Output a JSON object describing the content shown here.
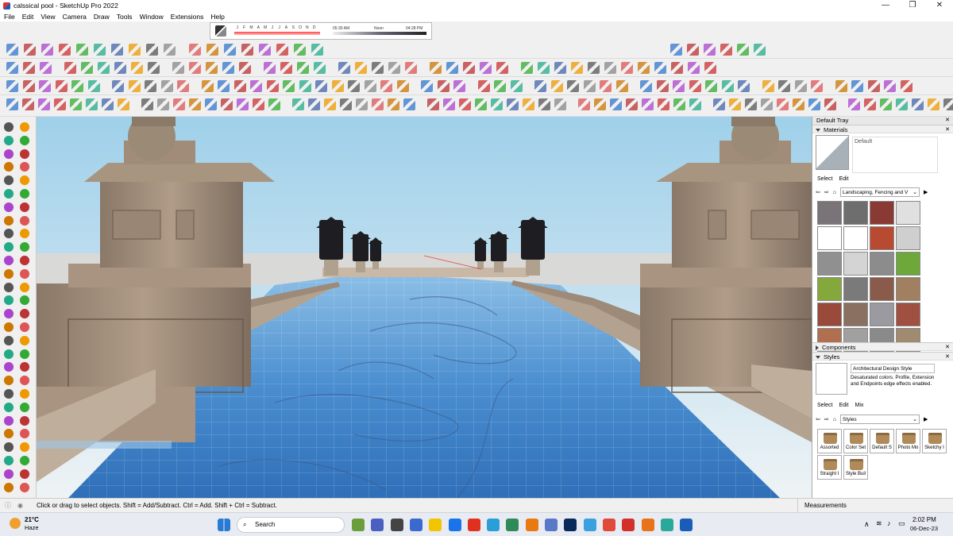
{
  "window": {
    "title": "calssical pool - SketchUp Pro 2022",
    "min": "—",
    "max": "❐",
    "close": "✕"
  },
  "menu": [
    "File",
    "Edit",
    "View",
    "Camera",
    "Draw",
    "Tools",
    "Window",
    "Extensions",
    "Help"
  ],
  "shadow": {
    "months": [
      "J",
      "F",
      "M",
      "A",
      "M",
      "J",
      "J",
      "A",
      "S",
      "O",
      "N",
      "D"
    ],
    "time_start": "05:30 AM",
    "time_noon": "Noon",
    "time_end": "04:28 PM"
  },
  "tray": {
    "title": "Default Tray",
    "materials": {
      "label": "Materials",
      "current": "Default",
      "tab_select": "Select",
      "tab_edit": "Edit",
      "library": "Landscaping, Fencing and V",
      "swatch_colors": [
        "#7a7478",
        "#6e6e6e",
        "#8a3a35",
        "#e0e0e0",
        "#ffffff",
        "#ffffff",
        "#b84a32",
        "#cfcfcf",
        "#909090",
        "#d4d4d4",
        "#8c8c8c",
        "#6fa83a",
        "#84a83c",
        "#7a7a7a",
        "#8a5a4a",
        "#a08060",
        "#9a4a3a",
        "#8a7060",
        "#9a9aa0",
        "#a05040",
        "#b07050",
        "#a0a0a0",
        "#8a8a8a",
        "#a08a70"
      ]
    },
    "components": {
      "label": "Components"
    },
    "styles": {
      "label": "Styles",
      "name": "Architectural Design Style",
      "description": "Desaturated colors. Profile, Extension and Endpoints edge effects enabled.",
      "tab_select": "Select",
      "tab_edit": "Edit",
      "tab_mix": "Mix",
      "library": "Styles",
      "items": [
        "Assorted",
        "Color Set",
        "Default S",
        "Photo Mo",
        "Sketchy I",
        "Straight I",
        "Style Buil"
      ]
    }
  },
  "status": {
    "hint": "Click or drag to select objects. Shift = Add/Subtract. Ctrl = Add. Shift + Ctrl = Subtract.",
    "measurements_label": "Measurements"
  },
  "taskbar": {
    "temp": "21°C",
    "weather": "Haze",
    "search": "Search",
    "time": "2:02 PM",
    "date": "06-Dec-23",
    "lang": "∧"
  }
}
